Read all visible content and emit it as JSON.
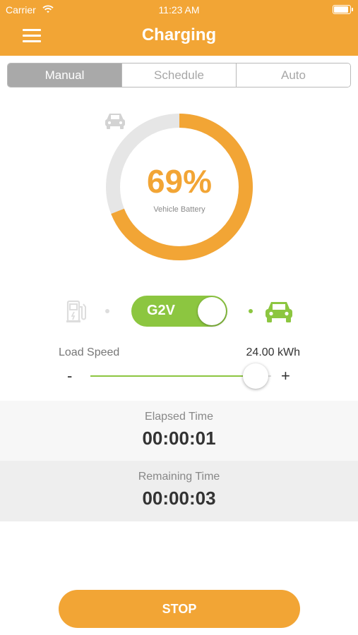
{
  "status_bar": {
    "carrier": "Carrier",
    "time": "11:23 AM",
    "wifi_icon": "wifi-icon",
    "battery_icon": "battery-icon",
    "battery_level": 0.95
  },
  "header": {
    "title": "Charging",
    "menu_icon": "hamburger-menu-icon",
    "background_color": "#f2a535"
  },
  "mode_tabs": [
    {
      "label": "Manual",
      "selected": true
    },
    {
      "label": "Schedule",
      "selected": false
    },
    {
      "label": "Auto",
      "selected": false
    }
  ],
  "battery": {
    "percent_text": "69%",
    "percent_value": 69,
    "label": "Vehicle Battery",
    "icon": "car-icon"
  },
  "mode_switch": {
    "label": "G2V",
    "left_icon": "fuel-pump-icon",
    "right_icon": "car-icon",
    "active_color": "#8cc640",
    "on": true
  },
  "load_speed": {
    "label": "Load Speed",
    "value": "24.00 kWh",
    "minus": "-",
    "plus": "+",
    "level": 0.88
  },
  "elapsed": {
    "label": "Elapsed Time",
    "value": "00:00:01"
  },
  "remaining": {
    "label": "Remaining Time",
    "value": "00:00:03"
  },
  "stop_button": {
    "label": "STOP"
  },
  "colors": {
    "accent": "#f2a535",
    "green": "#8cc640",
    "ring_track": "#e6e6e6"
  }
}
